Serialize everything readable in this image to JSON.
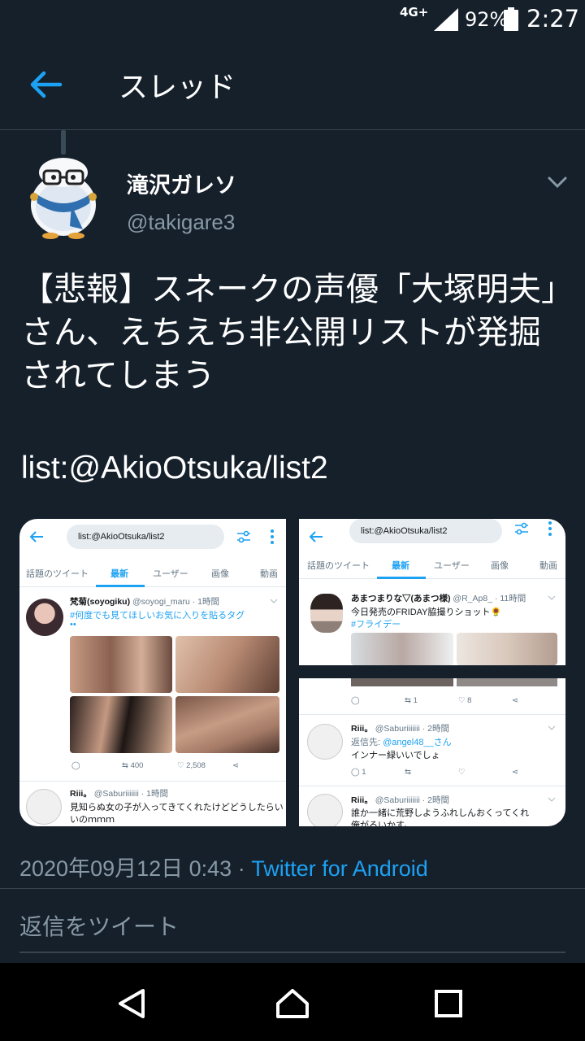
{
  "status_bar": {
    "network": "4G+",
    "battery": "92%",
    "time": "2:27"
  },
  "header": {
    "title": "スレッド",
    "back_icon": "arrow-left-icon"
  },
  "tweet": {
    "name": "滝沢ガレソ",
    "handle": "@takigare3",
    "text": "【悲報】スネークの声優「大塚明夫」さん、えちえち非公開リストが発掘されてしまう",
    "link": "list:@AkioOtsuka/list2",
    "date": "2020年09月12日 0:43",
    "dot": " · ",
    "source": "Twitter for Android"
  },
  "media": {
    "search_text": "list:@AkioOtsuka/list2",
    "tabs": [
      "話題のツイート",
      "最新",
      "ユーザー",
      "画像",
      "動画"
    ],
    "shotA": {
      "name": "梵菊(soyogiku)",
      "meta": "@soyogi_maru · 1時間",
      "line1": "#何度でも見てほしいお気に入りを貼るタグ",
      "line2": "••",
      "retweets": "400",
      "likes": "2,508",
      "reply_name": "Riii。",
      "reply_meta": "@Saburiiiiiii · 1時間",
      "reply_line1": "見知らぬ女の子が入ってきてくれたけどどうしたらい",
      "reply_line2": "いのｍｍｍ"
    },
    "shotB": {
      "name": "あまつまりな▽(あまつ様)",
      "meta": "@R_Ap8_ · 11時間",
      "line1": "今日発売のFRIDAY脇撮りショット🌻",
      "line2": "#フライデー"
    },
    "shotC": {
      "retweets": "1",
      "likes": "8",
      "r1_name": "Riii。",
      "r1_meta": "@Saburiiiiiii · 2時間",
      "r1_reply_to_label": "返信先: ",
      "r1_reply_to": "@angel48__さん",
      "r1_line": "インナー緑いいでしょ",
      "r1_replies": "1",
      "r2_name": "Riii。",
      "r2_meta": "@Saburiiiiiii · 2時間",
      "r2_line1": "誰か一緒に荒野しようふれしんおくってくれ",
      "r2_line2": "俺がるいかす。"
    }
  },
  "reply_placeholder": "返信をツイート",
  "colors": {
    "background": "#15202b",
    "accent": "#1da1f2",
    "muted": "#8899a6",
    "border": "#38444d"
  }
}
